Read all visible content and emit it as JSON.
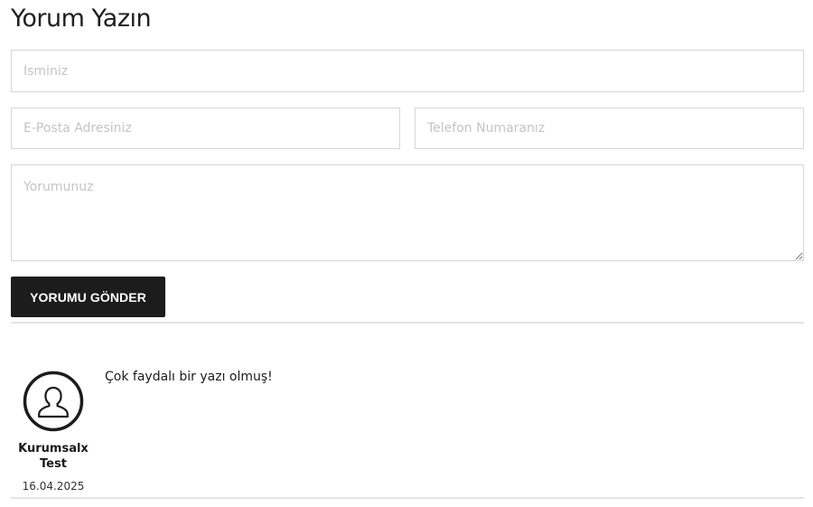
{
  "form": {
    "title": "Yorum Yazın",
    "name_placeholder": "İsminiz",
    "email_placeholder": "E-Posta Adresiniz",
    "phone_placeholder": "Telefon Numaranız",
    "comment_placeholder": "Yorumunuz",
    "submit_label": "YORUMU GÖNDER"
  },
  "comments": [
    {
      "author_line1": "Kurumsalx",
      "author_line2": "Test",
      "date": "16.04.2025",
      "text": "Çok faydalı bir yazı olmuş!",
      "avatar_icon": "user-icon"
    }
  ],
  "colors": {
    "button_bg": "#1c1c1c",
    "button_text": "#ffffff",
    "border": "#d6d6d6",
    "placeholder": "#c4c4c4",
    "divider": "#e4e4e4"
  }
}
